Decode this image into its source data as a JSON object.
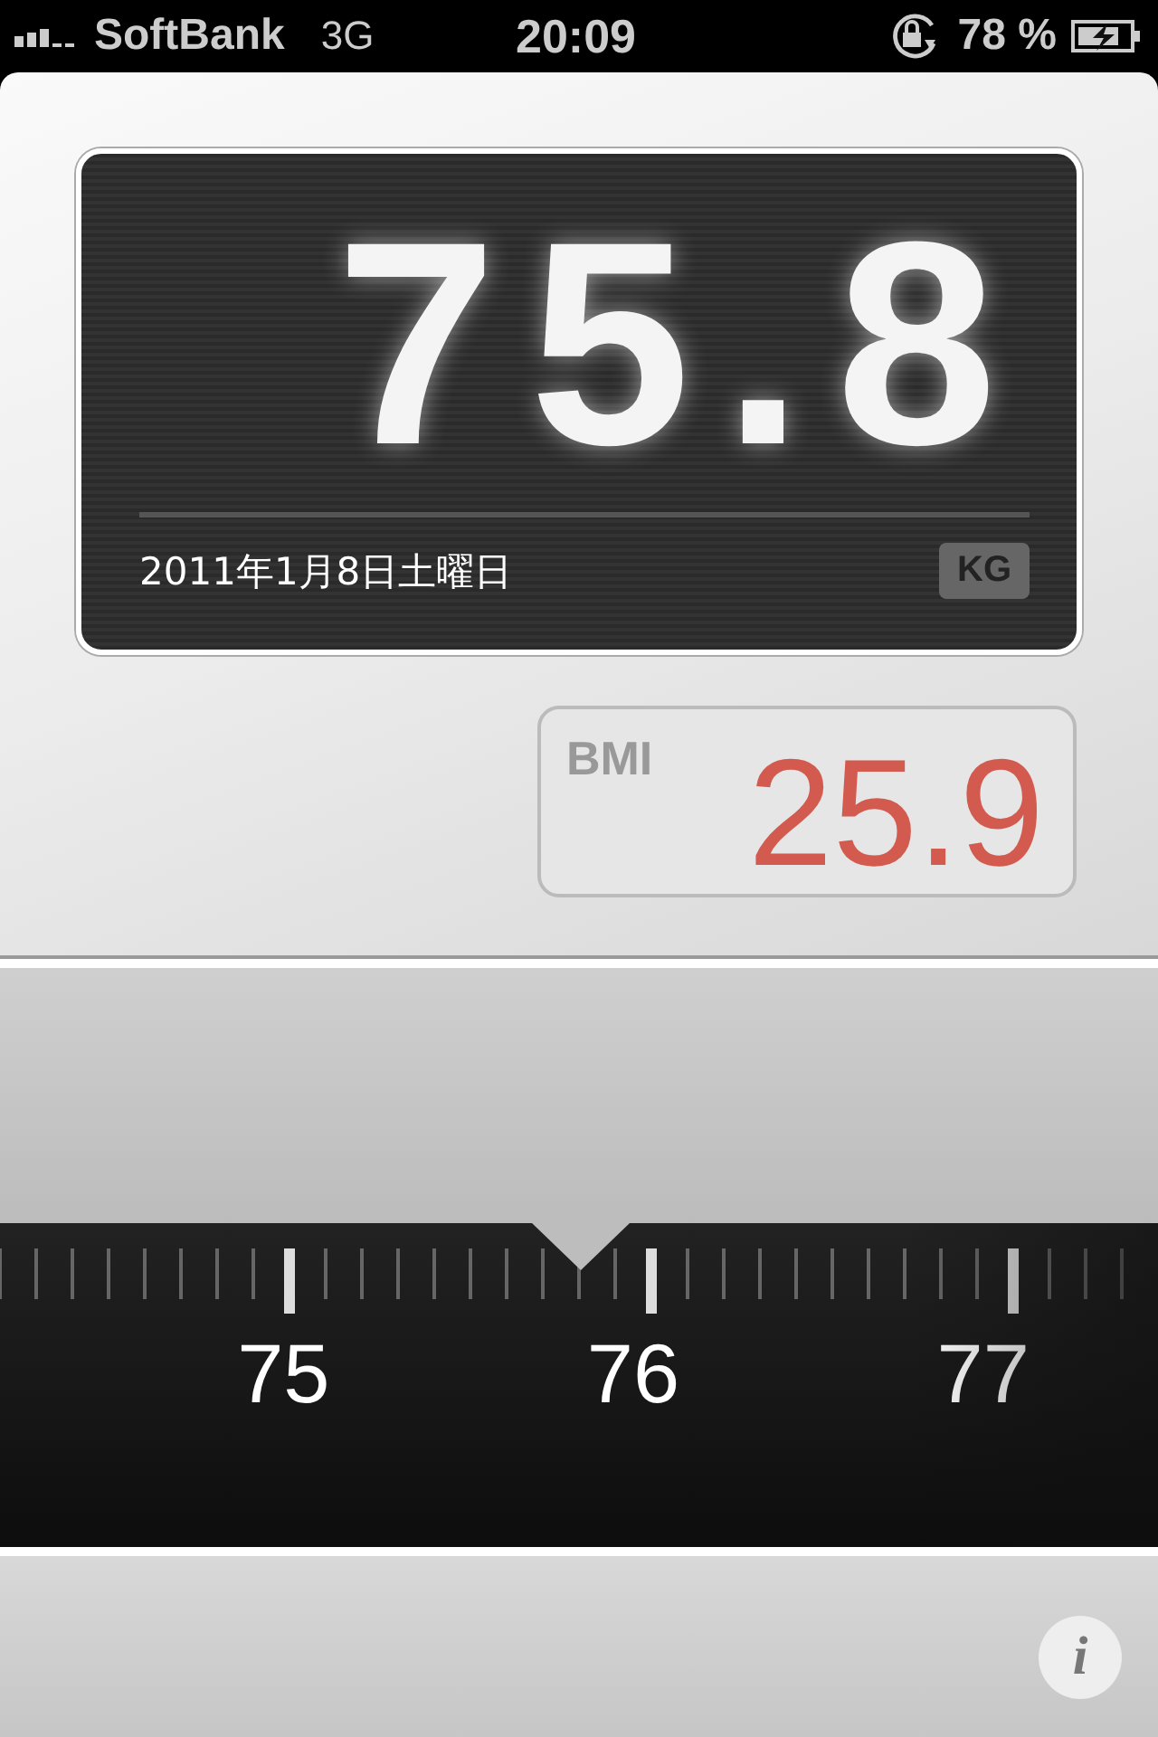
{
  "status_bar": {
    "carrier": "SoftBank",
    "network": "3G",
    "time": "20:09",
    "battery": "78 %"
  },
  "display": {
    "weight": "75.8",
    "date": "2011年1月8日土曜日",
    "unit": "KG"
  },
  "bmi": {
    "label": "BMI",
    "value": "25.9"
  },
  "ruler": {
    "labels": [
      "75",
      "76",
      "77"
    ]
  },
  "info_button": {
    "label": "i"
  }
}
